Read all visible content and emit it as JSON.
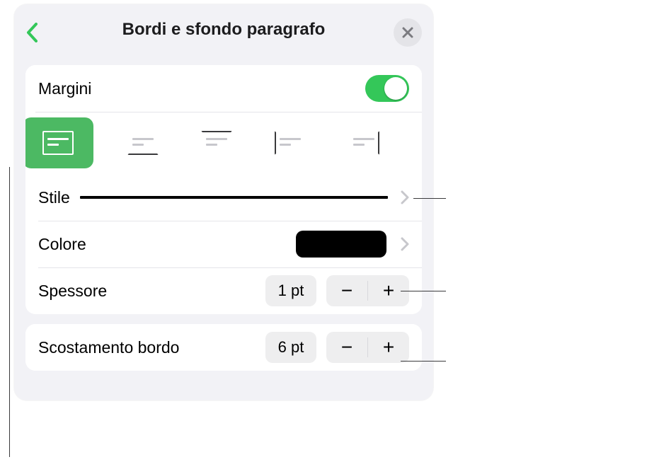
{
  "header": {
    "title": "Bordi e sfondo paragrafo"
  },
  "margins": {
    "label": "Margini",
    "enabled": true
  },
  "border_presets": {
    "selected_index": 0,
    "items": [
      "all",
      "bottom",
      "top",
      "left",
      "right"
    ]
  },
  "style_row": {
    "label": "Stile"
  },
  "color_row": {
    "label": "Colore",
    "value_hex": "#000000"
  },
  "thickness_row": {
    "label": "Spessore",
    "value": "1 pt"
  },
  "offset_row": {
    "label": "Scostamento bordo",
    "value": "6 pt"
  }
}
